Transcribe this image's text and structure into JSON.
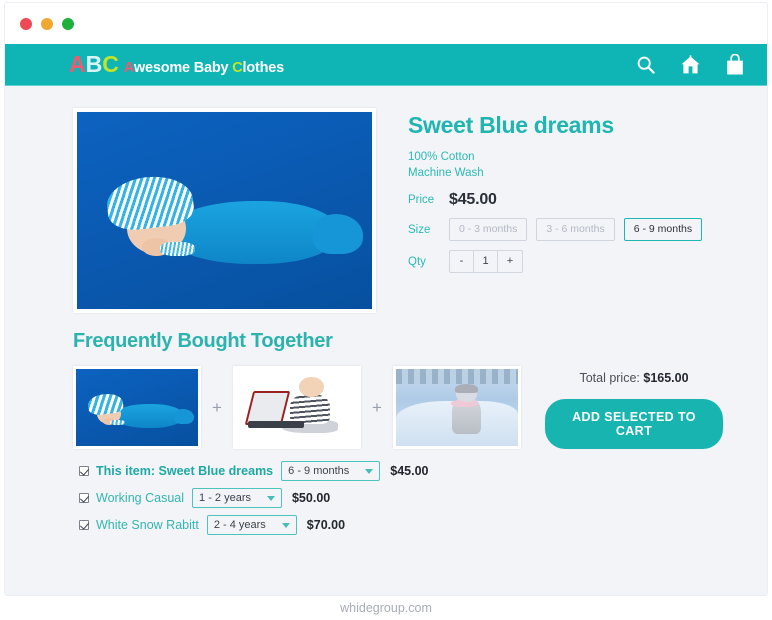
{
  "window": {
    "controls": [
      {
        "name": "close",
        "color": "#ed4a55"
      },
      {
        "name": "minimize",
        "color": "#f0a830"
      },
      {
        "name": "maximize",
        "color": "#1cb03c"
      }
    ]
  },
  "header": {
    "background": "#0fb5b5",
    "logo": {
      "initials": [
        {
          "letter": "A",
          "color": "#f05a6e"
        },
        {
          "letter": "B",
          "color": "#d9f4f7"
        },
        {
          "letter": "C",
          "color": "#c3e327"
        }
      ],
      "words": [
        {
          "text": "A",
          "color": "#f05a6e"
        },
        {
          "text": "wesome Baby ",
          "color": "#ffffff"
        },
        {
          "text": "C",
          "color": "#c3e327"
        },
        {
          "text": "lothes",
          "color": "#ffffff"
        }
      ],
      "full_text": "ABC Awesome Baby Clothes"
    },
    "icons": [
      "search-icon",
      "home-icon",
      "shopping-bag-icon"
    ]
  },
  "product": {
    "title": "Sweet Blue dreams",
    "description_lines": [
      "100% Cotton",
      "Machine Wash"
    ],
    "price_label": "Price",
    "price": "$45.00",
    "size_label": "Size",
    "sizes": [
      {
        "label": "0 - 3 months",
        "selected": false
      },
      {
        "label": "3 - 6 months",
        "selected": false
      },
      {
        "label": "6 - 9 months",
        "selected": true
      }
    ],
    "qty_label": "Qty",
    "qty_minus": "-",
    "qty_value": "1",
    "qty_plus": "+",
    "image_alt": "sleeping-baby-in-blue-wrap"
  },
  "fbt": {
    "title": "Frequently Bought Together",
    "plus_symbol": "+",
    "thumbnails": [
      {
        "alt": "sleeping-baby-in-blue-wrap"
      },
      {
        "alt": "baby-with-laptop"
      },
      {
        "alt": "child-in-snow-suit"
      }
    ],
    "total_label": "Total price:",
    "total_price": "$165.00",
    "cart_button": "ADD SELECTED TO CART",
    "accent_color": "#18b5b0",
    "items": [
      {
        "label": "This item: Sweet Blue dreams",
        "bold": true,
        "checked": true,
        "option": "6 - 9 months",
        "price": "$45.00"
      },
      {
        "label": "Working Casual",
        "bold": false,
        "checked": true,
        "option": "1 - 2  years",
        "price": "$50.00"
      },
      {
        "label": "White Snow Rabitt",
        "bold": false,
        "checked": true,
        "option": "2 - 4  years",
        "price": "$70.00"
      }
    ]
  },
  "footer": {
    "text": "whidegroup.com"
  }
}
